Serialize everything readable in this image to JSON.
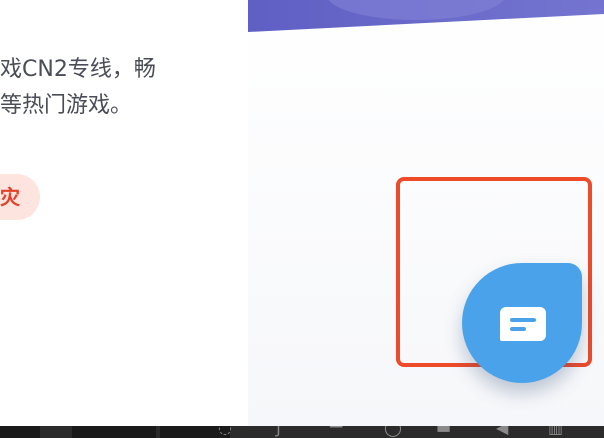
{
  "content": {
    "description_lines": [
      "戏CN2专线，畅",
      "等热门游戏。"
    ],
    "tag_label": "灾"
  },
  "colors": {
    "banner": "#6f6fcc",
    "tag_background": "#fde4df",
    "tag_text": "#e2412a",
    "highlight_border": "#ee4b2b",
    "chat_button": "#4aa3ea"
  },
  "chat_button": {
    "icon": "chat-bubble-icon"
  }
}
